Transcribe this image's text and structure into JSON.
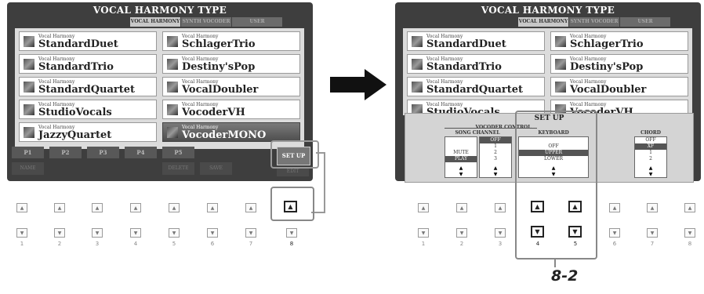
{
  "left": {
    "title": "VOCAL HARMONY TYPE",
    "tabs": [
      "VOCAL HARMONY",
      "SYNTH VOCODER",
      "USER"
    ],
    "cards": [
      {
        "cat": "Vocal Harmony",
        "name": "StandardDuet"
      },
      {
        "cat": "Vocal Harmony",
        "name": "SchlagerTrio"
      },
      {
        "cat": "Vocal Harmony",
        "name": "StandardTrio"
      },
      {
        "cat": "Vocal Harmony",
        "name": "Destiny'sPop"
      },
      {
        "cat": "Vocal Harmony",
        "name": "StandardQuartet"
      },
      {
        "cat": "Vocal Harmony",
        "name": "VocalDoubler"
      },
      {
        "cat": "Vocal Harmony",
        "name": "StudioVocals"
      },
      {
        "cat": "Vocal Harmony",
        "name": "VocoderVH"
      },
      {
        "cat": "Vocal Harmony",
        "name": "JazzyQuartet"
      },
      {
        "cat": "Vocal Harmony",
        "name": "VocoderMONO"
      }
    ],
    "pages": [
      "P1",
      "P2",
      "P3",
      "P4",
      "P5"
    ],
    "bottom": [
      "NAME",
      "DELETE",
      "SAVE"
    ],
    "setup": "SET UP",
    "edit": "EDIT"
  },
  "right": {
    "title": "VOCAL HARMONY TYPE",
    "tabs": [
      "VOCAL HARMONY",
      "SYNTH VOCODER",
      "USER"
    ],
    "cards": [
      {
        "cat": "Vocal Harmony",
        "name": "StandardDuet"
      },
      {
        "cat": "Vocal Harmony",
        "name": "SchlagerTrio"
      },
      {
        "cat": "Vocal Harmony",
        "name": "StandardTrio"
      },
      {
        "cat": "Vocal Harmony",
        "name": "Destiny'sPop"
      },
      {
        "cat": "Vocal Harmony",
        "name": "StandardQuartet"
      },
      {
        "cat": "Vocal Harmony",
        "name": "VocalDoubler"
      },
      {
        "cat": "Vocal Harmony",
        "name": "StudioVocals"
      },
      {
        "cat": "Vocal Harmony",
        "name": "VocoderVH"
      }
    ]
  },
  "setup_panel": {
    "title": "SET UP",
    "vocoder_label": "VOCODER CONTROL",
    "song_channel": "SONG CHANNEL",
    "song_items1": [
      "MUTE",
      "PLAY"
    ],
    "song_items2": [
      "OFF",
      "1",
      "2",
      "3"
    ],
    "keyboard": "KEYBOARD",
    "keyboard_items": [
      "OFF",
      "UPPER",
      "LOWER"
    ],
    "chord": "CHORD",
    "chord_items": [
      "OFF",
      "XF",
      "1",
      "2"
    ]
  },
  "button_numbers": [
    "1",
    "2",
    "3",
    "4",
    "5",
    "6",
    "7",
    "8"
  ],
  "callout": "8-2",
  "colors": {
    "screen": "#3e3e3e",
    "selected": "#555555"
  }
}
